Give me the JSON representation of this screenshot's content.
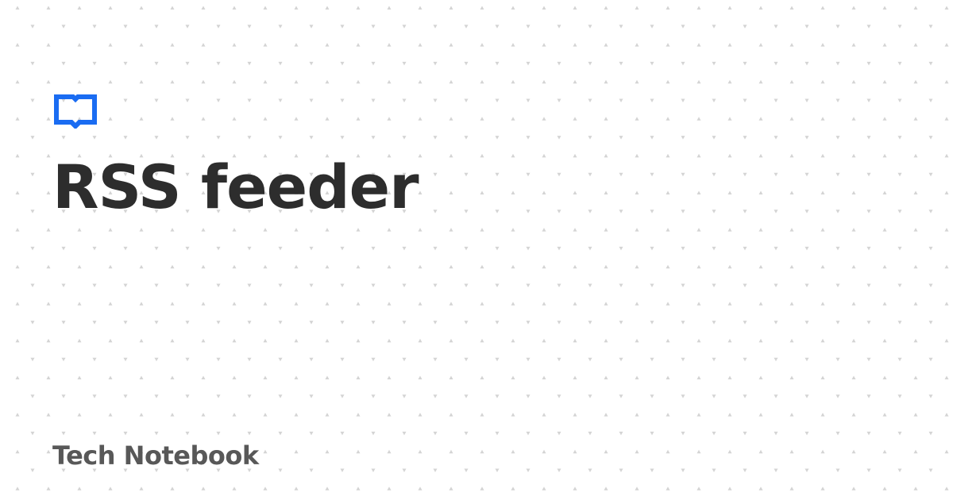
{
  "card": {
    "title": "RSS feeder",
    "site_name": "Tech Notebook",
    "logo_icon": "book-icon",
    "colors": {
      "background": "#ffffff",
      "accent": "#1a6cf2",
      "title": "#2d2d2d",
      "site_name": "#585858",
      "pattern": "#d4d4d4"
    }
  }
}
